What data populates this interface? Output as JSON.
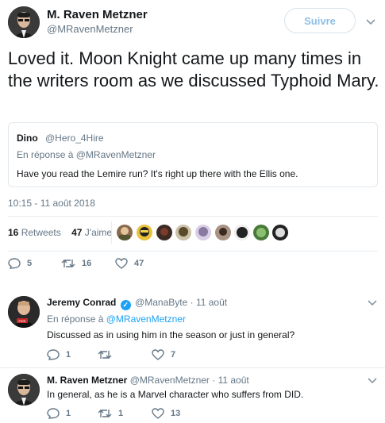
{
  "main_tweet": {
    "author_name": "M. Raven Metzner",
    "author_handle": "@MRavenMetzner",
    "follow_label": "Suivre",
    "text": "Loved it.  Moon Knight came up many times in the writers room as we discussed Typhoid Mary.",
    "timestamp": "10:15 - 11 août 2018",
    "retweets_count": "16",
    "retweets_label": "Retweets",
    "likes_count": "47",
    "likes_label": "J'aime",
    "actions": {
      "replies": "5",
      "retweets": "16",
      "likes": "47"
    }
  },
  "quoted_tweet": {
    "name": "Dino",
    "handle": "@Hero_4Hire",
    "reply_prefix": "En réponse à",
    "reply_to": "@MRavenMetzner",
    "text": "Have you read the Lemire run? It's right up there with the Ellis one."
  },
  "replies": [
    {
      "author_name": "Jeremy Conrad",
      "handle": "@ManaByte",
      "date": "· 11 août",
      "reply_prefix": "En réponse à",
      "reply_to": "@MRavenMetzner",
      "text": "Discussed as in using him in the season or just in general?",
      "actions": {
        "replies": "1",
        "retweets": "",
        "likes": "7"
      }
    },
    {
      "author_name": "M. Raven Metzner",
      "handle": "@MRavenMetzner",
      "date": "· 11 août",
      "text": "In general, as he is a Marvel character who suffers from DID.",
      "actions": {
        "replies": "1",
        "retweets": "1",
        "likes": "13"
      }
    }
  ],
  "colors": {
    "accent": "#1da1f2",
    "muted_text": "#657786",
    "divider": "#e6ecf0",
    "follow_text": "#8ebfe8"
  },
  "icons": [
    "reply-icon",
    "retweet-icon",
    "like-icon",
    "chevron-down-icon",
    "verified-icon"
  ]
}
